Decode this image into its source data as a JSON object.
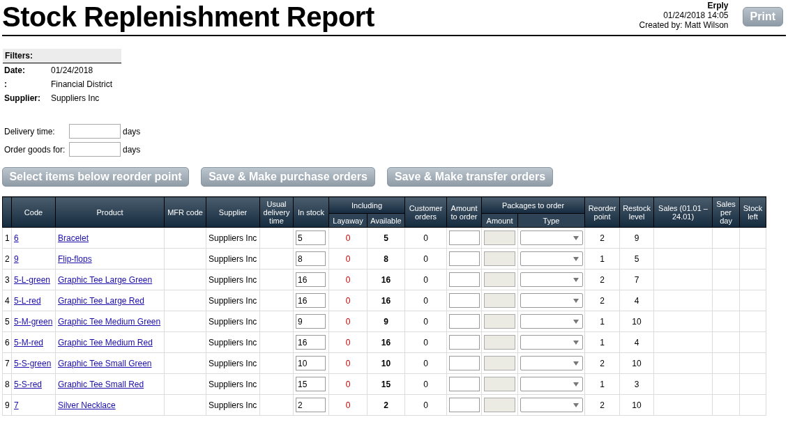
{
  "title": "Stock Replenishment Report",
  "meta": {
    "company": "Erply",
    "datetime": "01/24/2018 14:05",
    "created_by": "Created by: Matt Wilson"
  },
  "print_button": "Print",
  "filters": {
    "heading": "Filters:",
    "rows": [
      {
        "label": "Date:",
        "value": "01/24/2018"
      },
      {
        "label": ":",
        "value": "Financial District"
      },
      {
        "label": "Supplier:",
        "value": "Suppliers Inc"
      }
    ]
  },
  "settings": [
    {
      "label": "Delivery time:",
      "unit": "days"
    },
    {
      "label": "Order goods for:",
      "unit": "days"
    }
  ],
  "actions": [
    "Select items below reorder point",
    "Save & Make purchase orders",
    "Save & Make transfer orders"
  ],
  "table": {
    "columns": [
      "Code",
      "Product",
      "MFR code",
      "Supplier",
      "Usual delivery time",
      "In stock",
      "Including",
      "Customer orders",
      "Amount to order",
      "Packages to order",
      "Reorder point",
      "Restock level",
      "Sales (01.01 – 24.01)",
      "Sales per day",
      "Stock left"
    ],
    "subcolumns": [
      "Layaway",
      "Available",
      "Amount",
      "Type"
    ],
    "rows": [
      {
        "num": "1",
        "code": "6",
        "product": "Bracelet",
        "supplier": "Suppliers Inc",
        "in_stock": "5",
        "layaway": "0",
        "available": "5",
        "customer_orders": "0",
        "package_amount_disabled": true,
        "reorder_point": "2",
        "restock_level": "9"
      },
      {
        "num": "2",
        "code": "9",
        "product": "Flip-flops",
        "supplier": "Suppliers Inc",
        "in_stock": "8",
        "layaway": "0",
        "available": "8",
        "customer_orders": "0",
        "package_amount_disabled": true,
        "reorder_point": "1",
        "restock_level": "5"
      },
      {
        "num": "3",
        "code": "5-L-green",
        "product": "Graphic Tee Large Green",
        "supplier": "Suppliers Inc",
        "in_stock": "16",
        "layaway": "0",
        "available": "16",
        "customer_orders": "0",
        "package_amount_disabled": true,
        "reorder_point": "2",
        "restock_level": "7"
      },
      {
        "num": "4",
        "code": "5-L-red",
        "product": "Graphic Tee Large Red",
        "supplier": "Suppliers Inc",
        "in_stock": "16",
        "layaway": "0",
        "available": "16",
        "customer_orders": "0",
        "package_amount_disabled": true,
        "reorder_point": "2",
        "restock_level": "4"
      },
      {
        "num": "5",
        "code": "5-M-green",
        "product": "Graphic Tee Medium Green",
        "supplier": "Suppliers Inc",
        "in_stock": "9",
        "layaway": "0",
        "available": "9",
        "customer_orders": "0",
        "package_amount_disabled": true,
        "reorder_point": "1",
        "restock_level": "10"
      },
      {
        "num": "6",
        "code": "5-M-red",
        "product": "Graphic Tee Medium Red",
        "supplier": "Suppliers Inc",
        "in_stock": "16",
        "layaway": "0",
        "available": "16",
        "customer_orders": "0",
        "package_amount_disabled": true,
        "reorder_point": "1",
        "restock_level": "4"
      },
      {
        "num": "7",
        "code": "5-S-green",
        "product": "Graphic Tee Small Green",
        "supplier": "Suppliers Inc",
        "in_stock": "10",
        "layaway": "0",
        "available": "10",
        "customer_orders": "0",
        "package_amount_disabled": true,
        "reorder_point": "2",
        "restock_level": "10"
      },
      {
        "num": "8",
        "code": "5-S-red",
        "product": "Graphic Tee Small Red",
        "supplier": "Suppliers Inc",
        "in_stock": "15",
        "layaway": "0",
        "available": "15",
        "customer_orders": "0",
        "package_amount_disabled": true,
        "reorder_point": "1",
        "restock_level": "3"
      },
      {
        "num": "9",
        "code": "7",
        "product": "Silver Necklace",
        "supplier": "Suppliers Inc",
        "in_stock": "2",
        "layaway": "0",
        "available": "2",
        "customer_orders": "0",
        "package_amount_disabled": true,
        "reorder_point": "2",
        "restock_level": "10"
      }
    ]
  }
}
